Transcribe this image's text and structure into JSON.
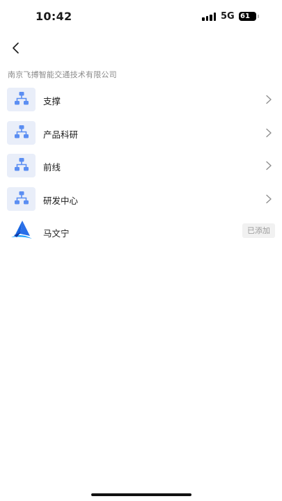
{
  "status_bar": {
    "time": "10:42",
    "network": "5G",
    "battery": "61"
  },
  "header": {
    "back_icon": "chevron-left-icon"
  },
  "organization": {
    "name": "南京飞搏智能交通技术有限公司"
  },
  "departments": [
    {
      "label": "支撑",
      "icon": "org-chart-icon"
    },
    {
      "label": "产品科研",
      "icon": "org-chart-icon"
    },
    {
      "label": "前线",
      "icon": "org-chart-icon"
    },
    {
      "label": "研发中心",
      "icon": "org-chart-icon"
    }
  ],
  "members": [
    {
      "name": "马文宁",
      "status": "已添加",
      "icon": "company-logo-icon"
    }
  ],
  "colors": {
    "icon_bg": "#e9eef9",
    "icon_fg": "#5b8ef2",
    "muted_text": "#8a8a8a",
    "badge_bg": "#f1f1f1"
  }
}
